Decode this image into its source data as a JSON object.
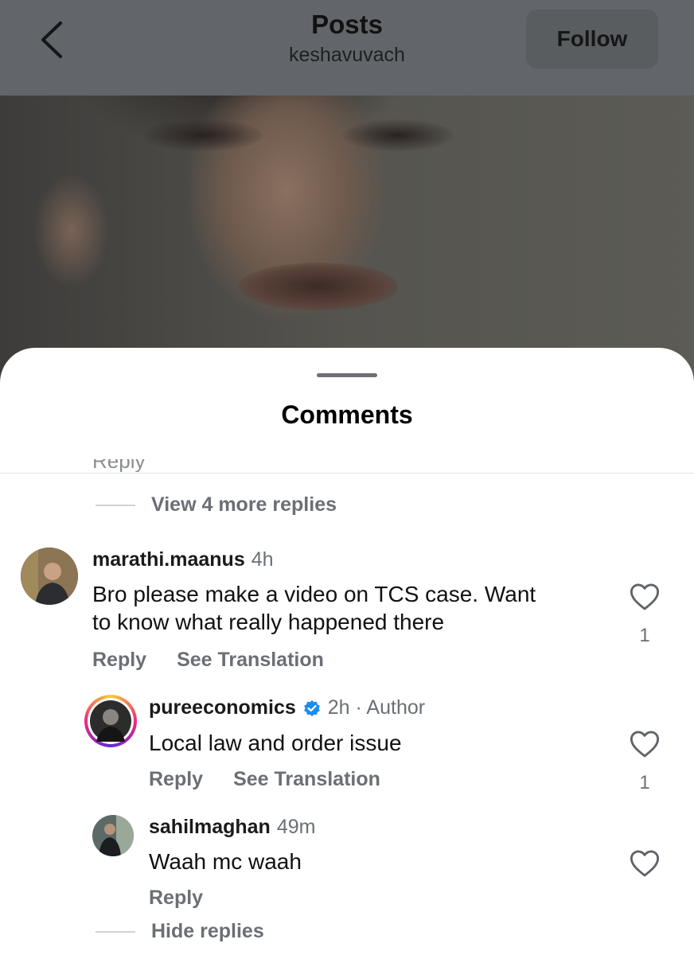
{
  "header": {
    "title": "Posts",
    "subtitle": "keshavuvach",
    "follow_label": "Follow"
  },
  "sheet": {
    "title": "Comments",
    "partial_text": "Reply",
    "view_more_label": "View 4 more replies",
    "hide_replies_label": "Hide replies"
  },
  "comments": [
    {
      "username": "marathi.maanus",
      "time": "4h",
      "text_line1": "Bro please make a video on TCS case. Want",
      "text_line2": "to know what really happened there",
      "reply_label": "Reply",
      "translate_label": "See Translation",
      "likes": "1"
    },
    {
      "username": "pureeconomics",
      "time": "2h · Author",
      "text": "Local law and order issue",
      "reply_label": "Reply",
      "translate_label": "See Translation",
      "likes": "1",
      "verified": true
    },
    {
      "username": "sahilmaghan",
      "time": "49m",
      "text": "Waah mc waah",
      "reply_label": "Reply"
    }
  ],
  "icons": {
    "back": "chevron-left-icon",
    "heart": "heart-outline-icon",
    "verified": "verified-badge-icon"
  },
  "colors": {
    "verified_blue": "#1d8cf0",
    "muted_text": "#6b6f75",
    "story_ring": "#d62976"
  }
}
